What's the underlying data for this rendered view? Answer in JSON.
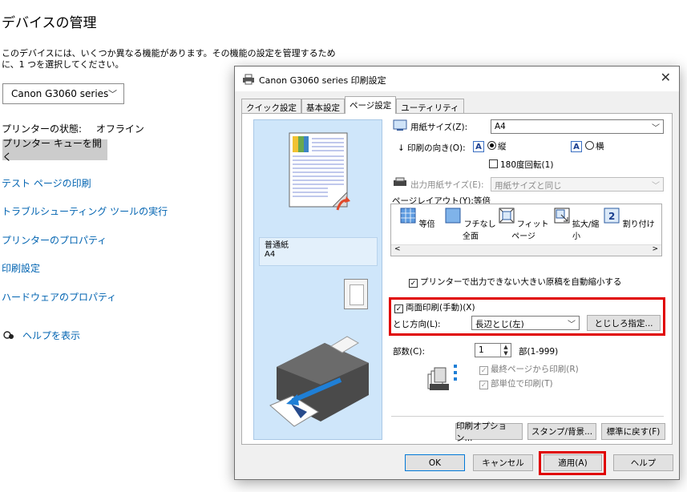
{
  "settings": {
    "title": "デバイスの管理",
    "description": "このデバイスには、いくつか異なる機能があります。その機能の設定を管理するために、1 つを選択してください。",
    "device_select": "Canon G3060 series",
    "status_label": "プリンターの状態:",
    "status_value": "オフライン",
    "queue_button": "プリンター キューを開く",
    "links": [
      "テスト ページの印刷",
      "トラブルシューティング ツールの実行",
      "プリンターのプロパティ",
      "印刷設定",
      "ハードウェアのプロパティ"
    ],
    "help": "ヘルプを表示"
  },
  "dialog": {
    "title": "Canon G3060 series 印刷設定",
    "close": "✕",
    "tabs": [
      "クイック設定",
      "基本設定",
      "ページ設定",
      "ユーティリティ"
    ],
    "active_tab": 2,
    "paper_info": {
      "type": "普通紙",
      "size": "A4"
    },
    "paper_size_label": "用紙サイズ(Z):",
    "paper_size_value": "A4",
    "orientation_label": "印刷の向き(O):",
    "orientation_portrait": "縦",
    "orientation_landscape": "横",
    "orientation_selected": "portrait",
    "rotate_label": "180度回転(1)",
    "rotate_checked": false,
    "output_size_label": "出力用紙サイズ(E):",
    "output_size_value": "用紙サイズと同じ",
    "layout_label": "ページレイアウト(Y):等倍",
    "layout_items": [
      "等倍",
      "フチなし全面",
      "フィットページ",
      "拡大/縮小",
      "割り付け"
    ],
    "auto_reduce_label": "プリンターで出力できない大きい原稿を自動縮小する",
    "auto_reduce_checked": true,
    "duplex_label": "両面印刷(手動)(X)",
    "duplex_checked": true,
    "binding_label": "とじ方向(L):",
    "binding_value": "長辺とじ(左)",
    "margin_button": "とじしろ指定...",
    "copies_label": "部数(C):",
    "copies_value": "1",
    "copies_range": "部(1-999)",
    "last_page_first": "最終ページから印刷(R)",
    "collate": "部単位で印刷(T)",
    "buttons_row": [
      "印刷オプション...",
      "スタンプ/背景...",
      "標準に戻す(F)"
    ],
    "footer_buttons": {
      "ok": "OK",
      "cancel": "キャンセル",
      "apply": "適用(A)",
      "help": "ヘルプ"
    }
  },
  "colors": {
    "highlight": "#e00000",
    "link": "#0063b1",
    "preview_bg": "#cfe6fa"
  }
}
